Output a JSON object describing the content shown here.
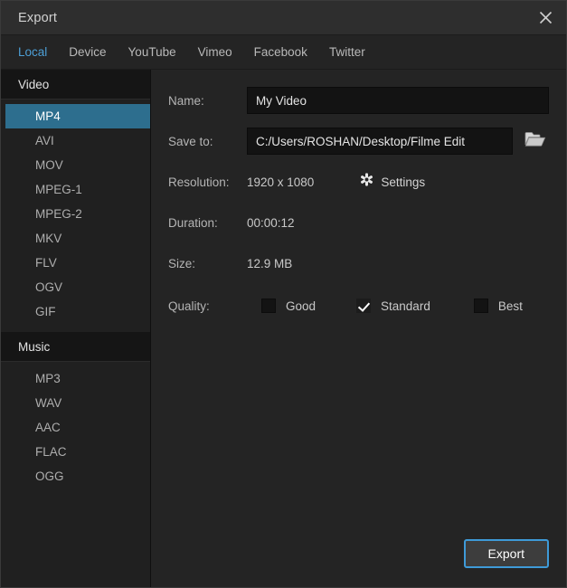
{
  "window": {
    "title": "Export",
    "close_icon": "close-icon"
  },
  "tabs": [
    {
      "label": "Local",
      "active": true
    },
    {
      "label": "Device",
      "active": false
    },
    {
      "label": "YouTube",
      "active": false
    },
    {
      "label": "Vimeo",
      "active": false
    },
    {
      "label": "Facebook",
      "active": false
    },
    {
      "label": "Twitter",
      "active": false
    }
  ],
  "sidebar": {
    "groups": [
      {
        "header": "Video",
        "items": [
          {
            "label": "MP4",
            "selected": true
          },
          {
            "label": "AVI",
            "selected": false
          },
          {
            "label": "MOV",
            "selected": false
          },
          {
            "label": "MPEG-1",
            "selected": false
          },
          {
            "label": "MPEG-2",
            "selected": false
          },
          {
            "label": "MKV",
            "selected": false
          },
          {
            "label": "FLV",
            "selected": false
          },
          {
            "label": "OGV",
            "selected": false
          },
          {
            "label": "GIF",
            "selected": false
          }
        ]
      },
      {
        "header": "Music",
        "items": [
          {
            "label": "MP3",
            "selected": false
          },
          {
            "label": "WAV",
            "selected": false
          },
          {
            "label": "AAC",
            "selected": false
          },
          {
            "label": "FLAC",
            "selected": false
          },
          {
            "label": "OGG",
            "selected": false
          }
        ]
      }
    ]
  },
  "form": {
    "name": {
      "label": "Name:",
      "value": "My Video",
      "placeholder": "My Video"
    },
    "save_to": {
      "label": "Save to:",
      "value": "C:/Users/ROSHAN/Desktop/Filme Edit",
      "placeholder": "C:/Users/ROSHAN/Desktop/Filme Edit",
      "browse_icon": "folder-icon"
    },
    "resolution": {
      "label": "Resolution:",
      "value": "1920 x 1080"
    },
    "settings": {
      "label": "Settings",
      "icon": "gear-icon"
    },
    "duration": {
      "label": "Duration:",
      "value": "00:00:12"
    },
    "size": {
      "label": "Size:",
      "value": "12.9 MB"
    },
    "quality": {
      "label": "Quality:",
      "options": [
        {
          "label": "Good",
          "checked": false
        },
        {
          "label": "Standard",
          "checked": true
        },
        {
          "label": "Best",
          "checked": false
        }
      ]
    }
  },
  "footer": {
    "export_label": "Export"
  },
  "colors": {
    "accent_blue": "#4d9fd6",
    "selection_blue": "#2d6e8e",
    "button_border_blue": "#3e9ad8",
    "panel_bg": "#242424",
    "sidebar_bg": "#202020",
    "titlebar_bg": "#2e2e2e",
    "input_bg": "#131313"
  }
}
